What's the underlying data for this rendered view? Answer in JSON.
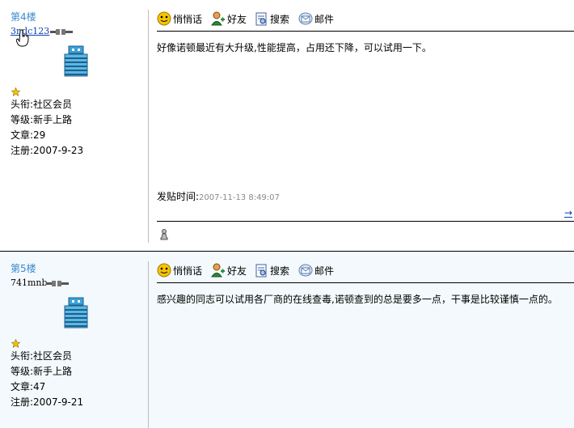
{
  "posts": [
    {
      "floor": "第4楼",
      "username": "3ndc123",
      "title": "头衔:社区会员",
      "level": "等级:新手上路",
      "articles": "文章:29",
      "registered": "注册:2007-9-23",
      "toolbar": {
        "whisper": "悄悄话",
        "friend": "好友",
        "search": "搜索",
        "mail": "邮件"
      },
      "content": "好像诺顿最近有大升级,性能提高，占用还下降，可以试用一下。",
      "time_label": "发贴时间:",
      "time_value": "2007-11-13 8:49:07",
      "arrow": "→"
    },
    {
      "floor": "第5楼",
      "username": "741mnb",
      "title": "头衔:社区会员",
      "level": "等级:新手上路",
      "articles": "文章:47",
      "registered": "注册:2007-9-21",
      "toolbar": {
        "whisper": "悄悄话",
        "friend": "好友",
        "search": "搜索",
        "mail": "邮件"
      },
      "content": "感兴趣的同志可以试用各厂商的在线查毒,诺顿查到的总是要多一点，干事是比较谨慎一点的。"
    }
  ],
  "colors": {
    "floor": "#3a8ad0",
    "link": "#0b3fb5",
    "time": "#8a8a8a",
    "post_bg_alt": "#f3f9fc"
  }
}
